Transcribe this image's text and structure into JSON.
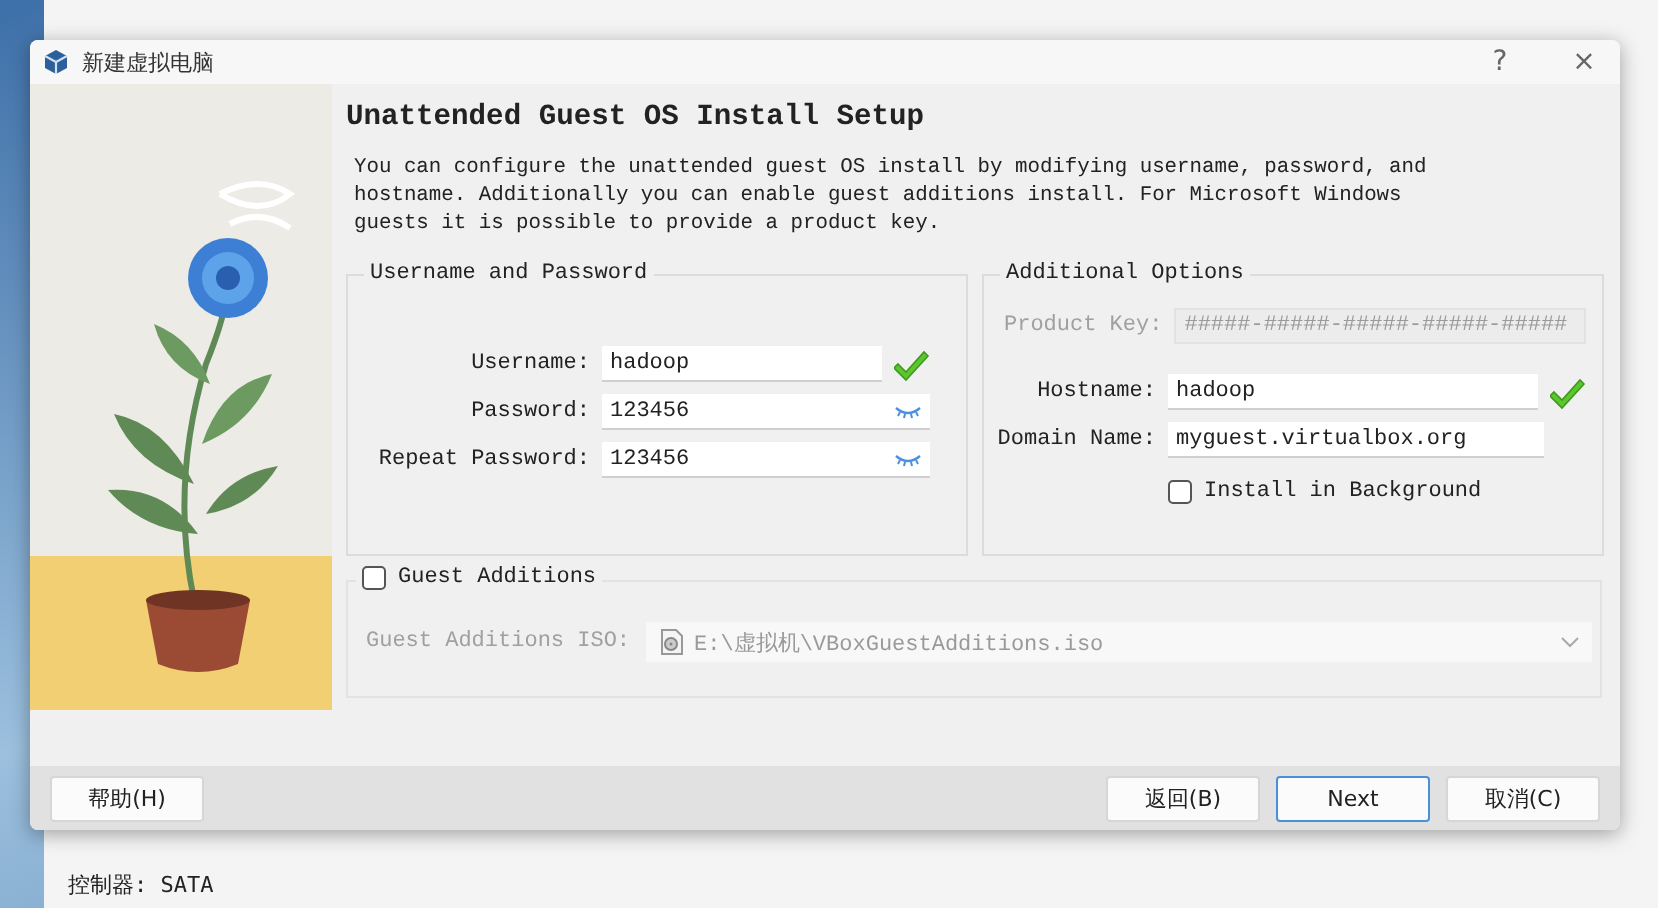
{
  "background_window": {
    "status_line": "控制器: SATA"
  },
  "dialog": {
    "title": "新建虚拟电脑",
    "help_glyph": "?",
    "close_glyph": "×"
  },
  "page": {
    "heading": "Unattended Guest OS Install Setup",
    "description": "You can configure the unattended guest OS install by modifying username, password, and hostname. Additionally you can enable guest additions install. For Microsoft Windows guests it is possible to provide a product key."
  },
  "credentials": {
    "title": "Username and Password",
    "fields": [
      {
        "label": "Username:",
        "value": "hadoop",
        "kind": "text",
        "valid": true
      },
      {
        "label": "Password:",
        "value": "123456",
        "kind": "password",
        "valid": false
      },
      {
        "label": "Repeat Password:",
        "value": "123456",
        "kind": "password",
        "valid": false
      }
    ]
  },
  "options": {
    "title": "Additional Options",
    "product_key": {
      "label": "Product Key:",
      "placeholder": "#####-#####-#####-#####-#####",
      "disabled": true
    },
    "fields": [
      {
        "label": "Hostname:",
        "value": "hadoop",
        "valid": true
      },
      {
        "label": "Domain Name:",
        "value": "myguest.virtualbox.org",
        "valid": false
      }
    ],
    "install_in_background": {
      "label": "Install in Background",
      "checked": false
    }
  },
  "guest_additions": {
    "label": "Guest Additions",
    "checked": false,
    "iso_label": "Guest Additions ISO:",
    "iso_path": "E:\\虚拟机\\VBoxGuestAdditions.iso",
    "disabled": true
  },
  "buttons": [
    {
      "label": "帮助(H)",
      "kind": "help",
      "default": false
    },
    {
      "label": "返回(B)",
      "kind": "nav",
      "default": false
    },
    {
      "label": "Next",
      "kind": "nav",
      "default": true
    },
    {
      "label": "取消(C)",
      "kind": "nav",
      "default": false
    }
  ]
}
